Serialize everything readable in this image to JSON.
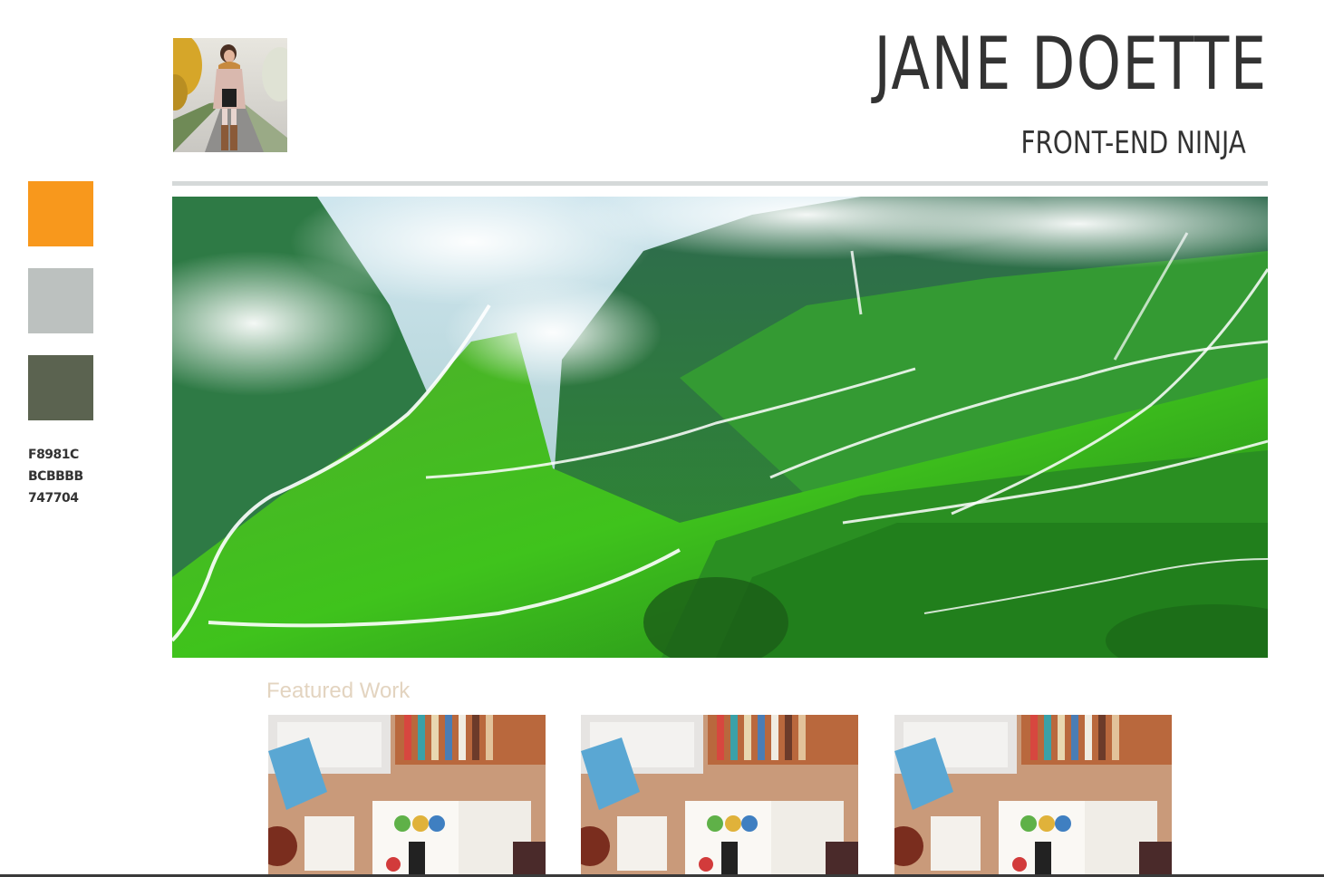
{
  "palette": {
    "colors": [
      "#F8981C",
      "#BCBBBB",
      "#5D6650"
    ],
    "codes": [
      "F8981C",
      "BCBBBB",
      "747704"
    ]
  },
  "header": {
    "name": "JANE DOETTE",
    "role": "FRONT-END NINJA"
  },
  "featured": {
    "heading": "Featured Work"
  },
  "images": {
    "avatar": "portrait-photo",
    "hero": "green-mountain-valley-photo",
    "thumbs": [
      "desk-workspace-photo",
      "desk-workspace-photo",
      "desk-workspace-photo"
    ]
  }
}
